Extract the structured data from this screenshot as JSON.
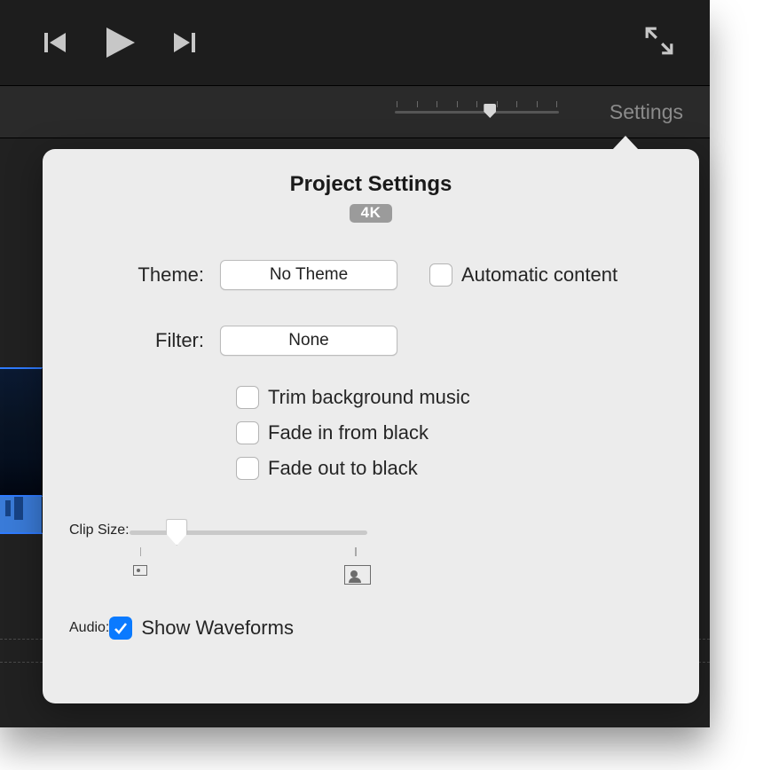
{
  "toolbar": {
    "settings_label": "Settings"
  },
  "popover": {
    "title": "Project Settings",
    "badge": "4K",
    "theme_label": "Theme:",
    "theme_value": "No Theme",
    "auto_content_label": "Automatic content",
    "filter_label": "Filter:",
    "filter_value": "None",
    "trim_label": "Trim background music",
    "fade_in_label": "Fade in from black",
    "fade_out_label": "Fade out to black",
    "clip_size_label": "Clip Size:",
    "audio_label": "Audio:",
    "waveforms_label": "Show Waveforms"
  },
  "state": {
    "auto_content_checked": false,
    "trim_checked": false,
    "fade_in_checked": false,
    "fade_out_checked": false,
    "waveforms_checked": true
  }
}
